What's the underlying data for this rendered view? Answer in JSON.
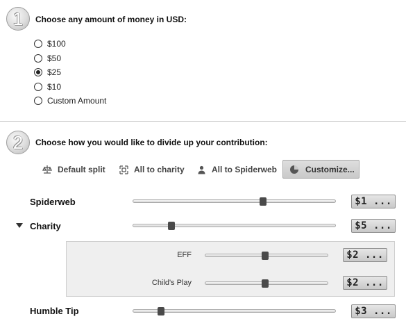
{
  "step1": {
    "number": "1",
    "title": "Choose any amount of money in USD:",
    "options": [
      {
        "label": "$100",
        "checked": false
      },
      {
        "label": "$50",
        "checked": false
      },
      {
        "label": "$25",
        "checked": true
      },
      {
        "label": "$10",
        "checked": false
      },
      {
        "label": "Custom Amount",
        "checked": false
      }
    ]
  },
  "step2": {
    "number": "2",
    "title": "Choose how you would like to divide up your contribution:",
    "split_options": [
      {
        "label": "Default split",
        "icon": "scale-icon"
      },
      {
        "label": "All to charity",
        "icon": "expand-arrows-icon"
      },
      {
        "label": "All to Spiderweb",
        "icon": "person-icon"
      },
      {
        "label": "Customize...",
        "icon": "pie-chart-icon",
        "active": true
      }
    ]
  },
  "allocations": {
    "spiderweb": {
      "label": "Spiderweb",
      "amount": "$1 ...",
      "slider_level": 0.64
    },
    "charity": {
      "label": "Charity",
      "amount": "$5 ...",
      "slider_level": 0.19,
      "expanded": true,
      "items": [
        {
          "label": "EFF",
          "amount": "$2 ...",
          "slider_level": 0.49
        },
        {
          "label": "Child's Play",
          "amount": "$2 ...",
          "slider_level": 0.49
        }
      ]
    },
    "humble_tip": {
      "label": "Humble Tip",
      "amount": "$3 ...",
      "slider_level": 0.14
    }
  }
}
